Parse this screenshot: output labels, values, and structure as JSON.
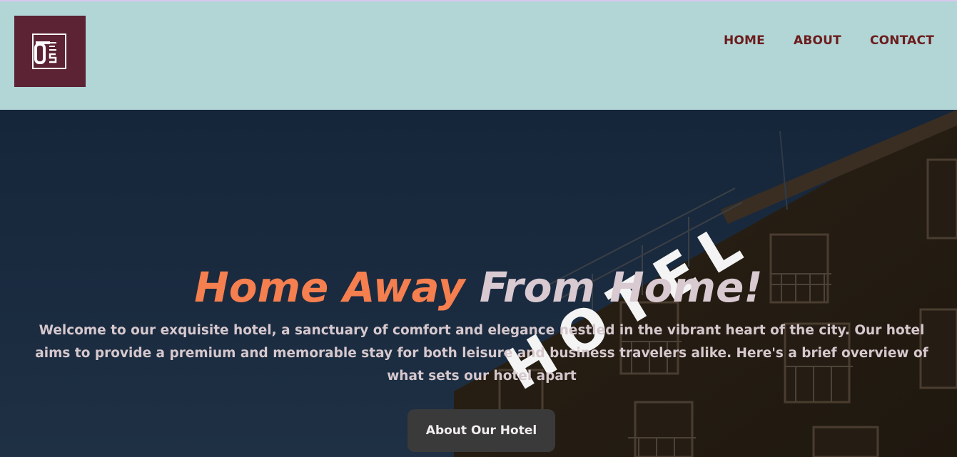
{
  "brand": {
    "logo_colors": {
      "background": "#5b2333",
      "mark": "#ffffff"
    }
  },
  "nav": {
    "items": [
      {
        "label": "HOME"
      },
      {
        "label": "ABOUT"
      },
      {
        "label": "CONTACT"
      }
    ],
    "color": "#6b1c1c"
  },
  "header": {
    "background": "#b2d5d6"
  },
  "hero": {
    "title_part_a": "Home Away ",
    "title_part_b": "From Home!",
    "sign_text": "HOTEL",
    "description": "Welcome to our exquisite hotel, a sanctuary of comfort and elegance nestled in the vibrant heart of the city. Our hotel aims to provide a premium and memorable stay for both leisure and business travelers alike. Here's a brief overview of what sets our hotel apart",
    "button_label": "About Our Hotel",
    "colors": {
      "accent": "#f57f4f",
      "title_light": "#d9c9d1",
      "button": "#3a3a3a"
    }
  }
}
